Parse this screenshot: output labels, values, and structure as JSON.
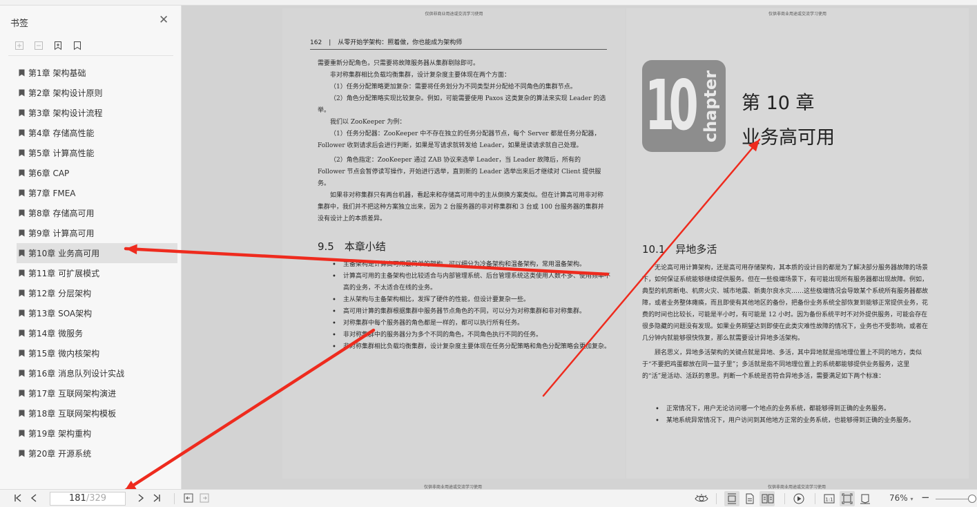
{
  "sidebar": {
    "title": "书签",
    "tools": [
      {
        "icon": "add-bookmark-icon"
      },
      {
        "icon": "remove-bookmark-icon"
      },
      {
        "icon": "bookmark-add-icon"
      },
      {
        "icon": "bookmark-icon"
      }
    ],
    "items": [
      {
        "label": "第1章 架构基础"
      },
      {
        "label": "第2章 架构设计原则"
      },
      {
        "label": "第3章 架构设计流程"
      },
      {
        "label": "第4章 存储高性能"
      },
      {
        "label": "第5章 计算高性能"
      },
      {
        "label": "第6章 CAP"
      },
      {
        "label": "第7章 FMEA"
      },
      {
        "label": "第8章 存储高可用"
      },
      {
        "label": "第9章 计算高可用"
      },
      {
        "label": "第10章 业务高可用"
      },
      {
        "label": "第11章 可扩展模式"
      },
      {
        "label": "第12章 分层架构"
      },
      {
        "label": "第13章 SOA架构"
      },
      {
        "label": "第14章 微服务"
      },
      {
        "label": "第15章 微内核架构"
      },
      {
        "label": "第16章 消息队列设计实战"
      },
      {
        "label": "第17章 互联网架构演进"
      },
      {
        "label": "第18章 互联网架构模板"
      },
      {
        "label": "第19章 架构重构"
      },
      {
        "label": "第20章 开源系统"
      }
    ],
    "active_index": 9
  },
  "left_page": {
    "watermark": "仅供非商业用途或交流学习使用",
    "page_number": "162",
    "running_head": "从零开始学架构：照着做，你也能成为架构师",
    "paragraphs": [
      "需要重新分配角色，只需要将故障服务器从集群剔除即可。",
      "非对称集群相比负载均衡集群，设计复杂度主要体现在两个方面：",
      "（1）任务分配策略更加复杂：需要将任务划分为不同类型并分配给不同角色的集群节点。",
      "（2）角色分配策略实现比较复杂。例如，可能需要使用 Paxos 这类复杂的算法来实现 Leader 的选举。",
      "我们以 ZooKeeper 为例：",
      "（1）任务分配器：ZooKeeper 中不存在独立的任务分配器节点，每个 Server 都是任务分配器，Follower 收到请求后会进行判断，如果是写请求就转发给 Leader，如果是读请求就自己处理。",
      "（2）角色指定：ZooKeeper 通过 ZAB 协议来选举 Leader，当 Leader 故障后，所有的 Follower 节点会暂停读写操作，开始进行选举，直到新的 Leader 选举出来后才继续对 Client 提供服务。",
      "如果非对称集群只有两台机器，看起来和存储高可用中的主从倒换方案类似。但在计算高可用非对称集群中，我们并不把这种方案独立出来，因为 2 台服务器的非对称集群和 3 台或 100 台服务器的集群并没有设计上的本质差异。"
    ],
    "section_title": "9.5　本章小结",
    "bullets": [
      "主备架构是计算高可用最简单的架构，可以细分为冷备架构和温备架构，常用温备架构。",
      "计算高可用的主备架构也比较适合与内部管理系统、后台管理系统这类使用人数不多、使用频率不高的业务，不太适合在线的业务。",
      "主从架构与主备架构相比，发挥了硬件的性能，但设计要复杂一些。",
      "高可用计算的集群根据集群中服务器节点角色的不同，可以分为对称集群和非对称集群。",
      "对称集群中每个服务器的角色都是一样的，都可以执行所有任务。",
      "非对称集群中的服务器分为多个不同的角色，不同角色执行不同的任务。",
      "非对称集群相比负载均衡集群，设计复杂度主要体现在任务分配策略和角色分配策略会更加复杂。"
    ],
    "footer_watermark": "仅供非商业用途或交流学习使用"
  },
  "right_page": {
    "watermark": "仅供非商业用途或交流学习使用",
    "logo_number": "10",
    "logo_word": "chapter",
    "chapter_number": "第 10 章",
    "chapter_name": "业务高可用",
    "section_title": "10.1　异地多活",
    "paragraphs": [
      "无论高可用计算架构，还是高可用存储架构，其本质的设计目的都是为了解决部分服务器故障的场景下，如何保证系统能够继续提供服务。但在一些极端场景下，有可能出现所有服务器都出现故障。例如，典型的机房断电、机房火灾、城市地震、新奥尔良水灾……这些极端情况会导致某个系统所有服务器都故障，或者业务整体瘫痪，而且即使有其他地区的备份，把备份业务系统全部恢复到能够正常提供业务，花费的时间也比较长，可能是半小时，有可能是 12 小时。因为备份系统平时不对外提供服务，可能会存在很多隐藏的问题没有发现。如果业务期望达到即使在此类灾难性故障的情况下，业务也不受影响，或者在几分钟内就能够很快恢复，那么就需要设计异地多活架构。",
      "顾名思义，异地多活架构的关键点就是异地、多活，其中异地就是指地理位置上不同的地方，类似于“不要把鸡蛋都放在同一篮子里”；多活就是指不同地理位置上的系统都能够提供业务服务，这里的“活”是活动、活跃的意思。判断一个系统是否符合异地多活，需要满足如下两个标准："
    ],
    "bullets": [
      "正常情况下，用户无论访问哪一个地点的业务系统，都能够得到正确的业务服务。",
      "某地系统异常情况下，用户访问到其他地方正常的业务系统，也能够得到正确的业务服务。"
    ],
    "footer_watermark": "仅供非商业用途或交流学习使用"
  },
  "toolbar": {
    "current_page": "181",
    "total_pages": "/329",
    "zoom_level": "76%",
    "zoom_caret": "▾",
    "first_icon": "first-page-icon",
    "prev_icon": "prev-page-icon",
    "next_icon": "next-page-icon",
    "last_icon": "last-page-icon",
    "minus": "−"
  },
  "annotation_color": "#ee2b1e"
}
